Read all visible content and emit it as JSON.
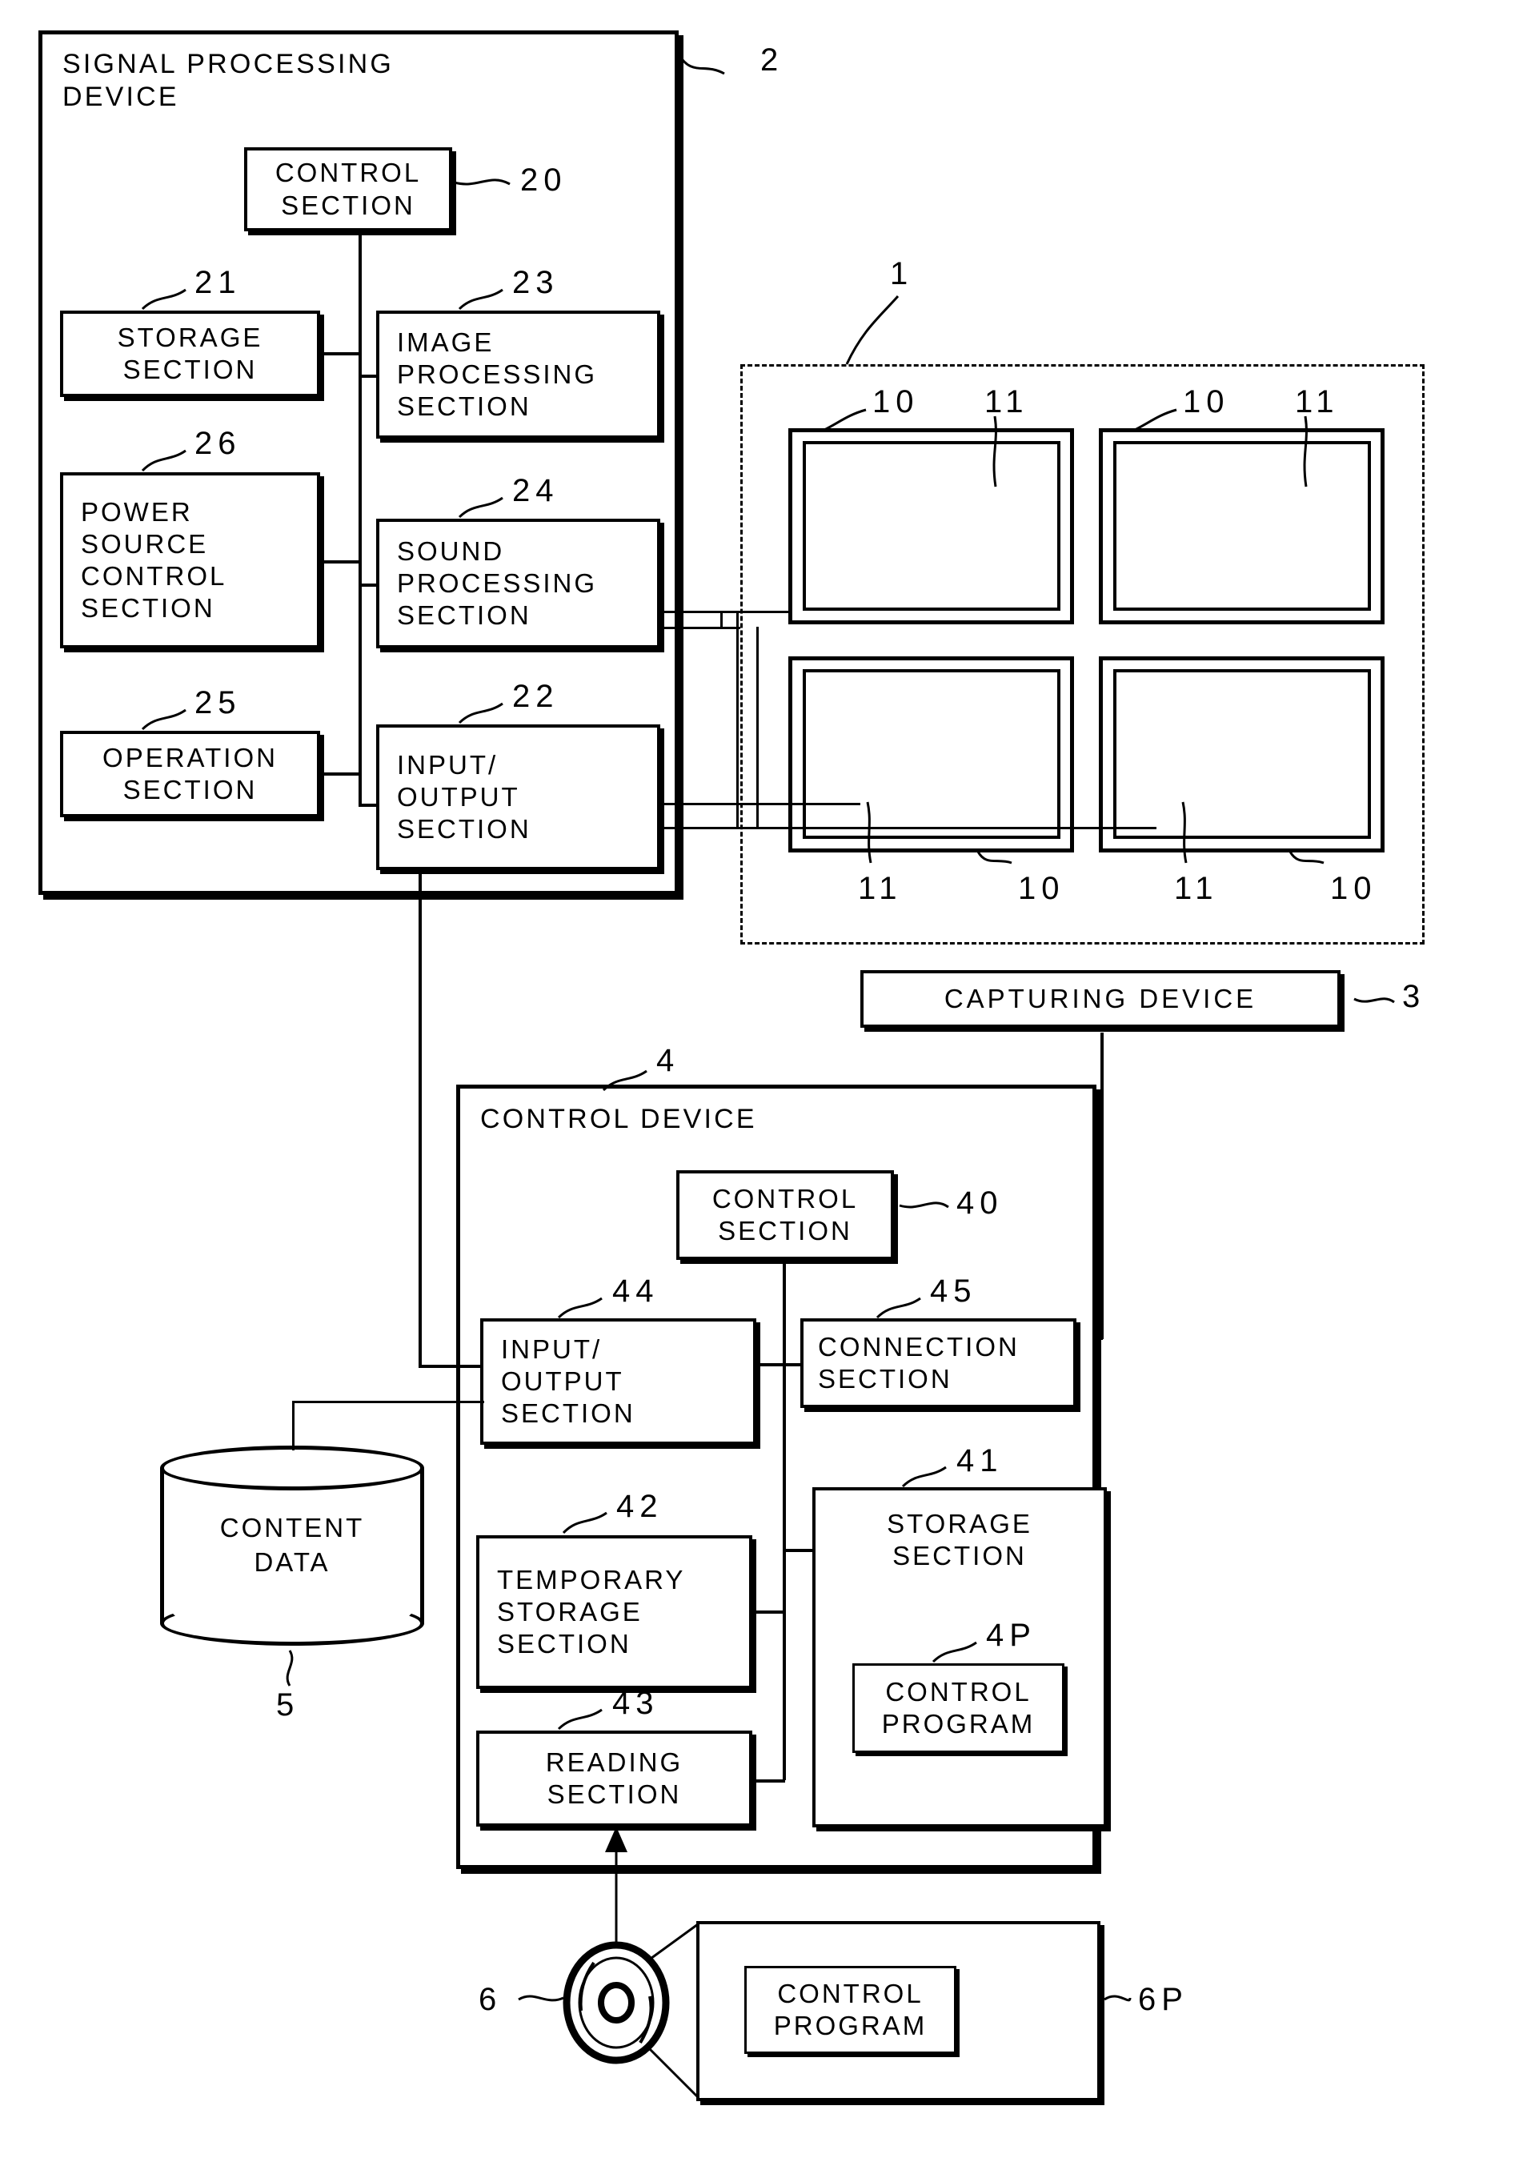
{
  "figure": {
    "signal_processing_device": {
      "title": "SIGNAL PROCESSING\nDEVICE",
      "ref": "2",
      "blocks": [
        {
          "label": "CONTROL\nSECTION",
          "ref": "20"
        },
        {
          "label": "STORAGE\nSECTION",
          "ref": "21"
        },
        {
          "label": "IMAGE\nPROCESSING\nSECTION",
          "ref": "23"
        },
        {
          "label": "POWER\nSOURCE\nCONTROL\nSECTION",
          "ref": "26"
        },
        {
          "label": "SOUND\nPROCESSING\nSECTION",
          "ref": "24"
        },
        {
          "label": "OPERATION\nSECTION",
          "ref": "25"
        },
        {
          "label": "INPUT/\nOUTPUT\nSECTION",
          "ref": "22"
        }
      ]
    },
    "capturing_device": {
      "group_ref": "1",
      "label": "CAPTURING DEVICE",
      "label_ref": "3",
      "panels": [
        {
          "outer_ref": "10",
          "inner_ref": "11"
        },
        {
          "outer_ref": "10",
          "inner_ref": "11"
        },
        {
          "inner_ref": "11",
          "outer_ref": "10"
        },
        {
          "inner_ref": "11",
          "outer_ref": "10"
        }
      ]
    },
    "control_device": {
      "title": "CONTROL DEVICE",
      "ref": "4",
      "blocks": [
        {
          "label": "CONTROL\nSECTION",
          "ref": "40"
        },
        {
          "label": "INPUT/\nOUTPUT\nSECTION",
          "ref": "44"
        },
        {
          "label": "CONNECTION\nSECTION",
          "ref": "45"
        },
        {
          "label": "TEMPORARY\nSTORAGE\nSECTION",
          "ref": "42"
        },
        {
          "label": "STORAGE\nSECTION",
          "ref": "41"
        },
        {
          "label": "CONTROL\nPROGRAM",
          "ref": "4P"
        },
        {
          "label": "READING\nSECTION",
          "ref": "43"
        }
      ]
    },
    "content_data": {
      "label": "CONTENT\nDATA",
      "ref": "5"
    },
    "recording_medium": {
      "ref": "6",
      "program_label": "CONTROL\nPROGRAM",
      "program_ref": "6P"
    }
  }
}
